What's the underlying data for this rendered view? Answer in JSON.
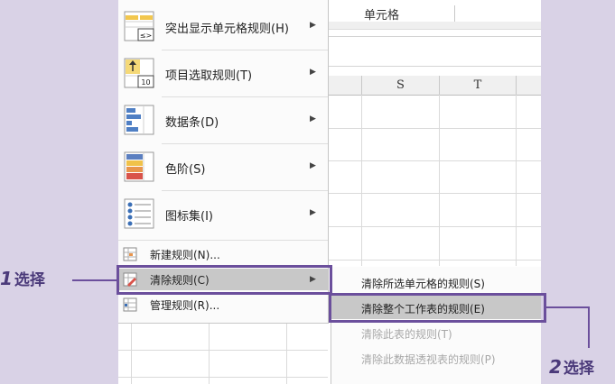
{
  "sheet": {
    "ribbon_label": "单元格",
    "columns": [
      "S",
      "T"
    ]
  },
  "menu": {
    "big_items": [
      {
        "label": "突出显示单元格规则(H)",
        "icon": "highlight-cells-rules-icon",
        "icon_text": "≤>"
      },
      {
        "label": "项目选取规则(T)",
        "icon": "top-bottom-rules-icon",
        "icon_text": "10"
      },
      {
        "label": "数据条(D)",
        "icon": "data-bars-icon"
      },
      {
        "label": "色阶(S)",
        "icon": "color-scales-icon"
      },
      {
        "label": "图标集(I)",
        "icon": "icon-sets-icon"
      }
    ],
    "small_items": [
      {
        "label": "新建规则(N)...",
        "icon": "new-rule-icon"
      },
      {
        "label": "清除规则(C)",
        "icon": "clear-rules-icon"
      },
      {
        "label": "管理规则(R)...",
        "icon": "manage-rules-icon"
      }
    ]
  },
  "submenu": {
    "items": [
      {
        "label": "清除所选单元格的规则(S)",
        "disabled": false
      },
      {
        "label": "清除整个工作表的规则(E)",
        "disabled": false
      },
      {
        "label": "清除此表的规则(T)",
        "disabled": true
      },
      {
        "label": "清除此数据透视表的规则(P)",
        "disabled": true
      }
    ]
  },
  "annotations": {
    "step1_num": "1",
    "step1_text": "选择",
    "step2_num": "2",
    "step2_text": "选择"
  },
  "colors": {
    "annotation": "#6b4f9c",
    "annotation_text": "#4b3a7a",
    "highlight": "#c8c8c8",
    "background": "#d9d2e6"
  }
}
